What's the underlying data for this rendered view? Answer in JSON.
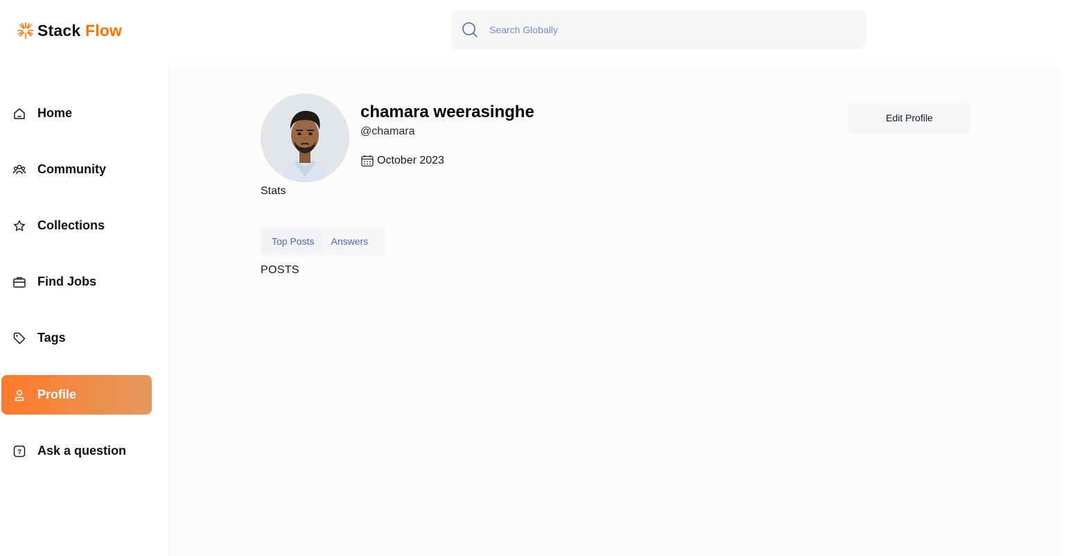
{
  "app": {
    "logo_word1": "Stack",
    "logo_word2": "Flow",
    "accent_color": "#ff7000"
  },
  "search": {
    "placeholder": "Search Globally",
    "icon": "search-icon"
  },
  "sidebar": {
    "items": [
      {
        "label": "Home",
        "icon": "home-icon"
      },
      {
        "label": "Community",
        "icon": "community-icon"
      },
      {
        "label": "Collections",
        "icon": "star-icon"
      },
      {
        "label": "Find Jobs",
        "icon": "briefcase-icon"
      },
      {
        "label": "Tags",
        "icon": "tag-icon"
      },
      {
        "label": "Profile",
        "icon": "user-icon",
        "active": true
      },
      {
        "label": "Ask a question",
        "icon": "question-icon"
      }
    ]
  },
  "profile": {
    "name": "chamara weerasinghe",
    "username": "@chamara",
    "joined": "October 2023",
    "edit_label": "Edit Profile",
    "stats_label": "Stats"
  },
  "tabs": {
    "items": [
      "Top Posts",
      "Answers"
    ],
    "selected": "Top Posts"
  },
  "content": {
    "posts_label": "POSTS"
  }
}
